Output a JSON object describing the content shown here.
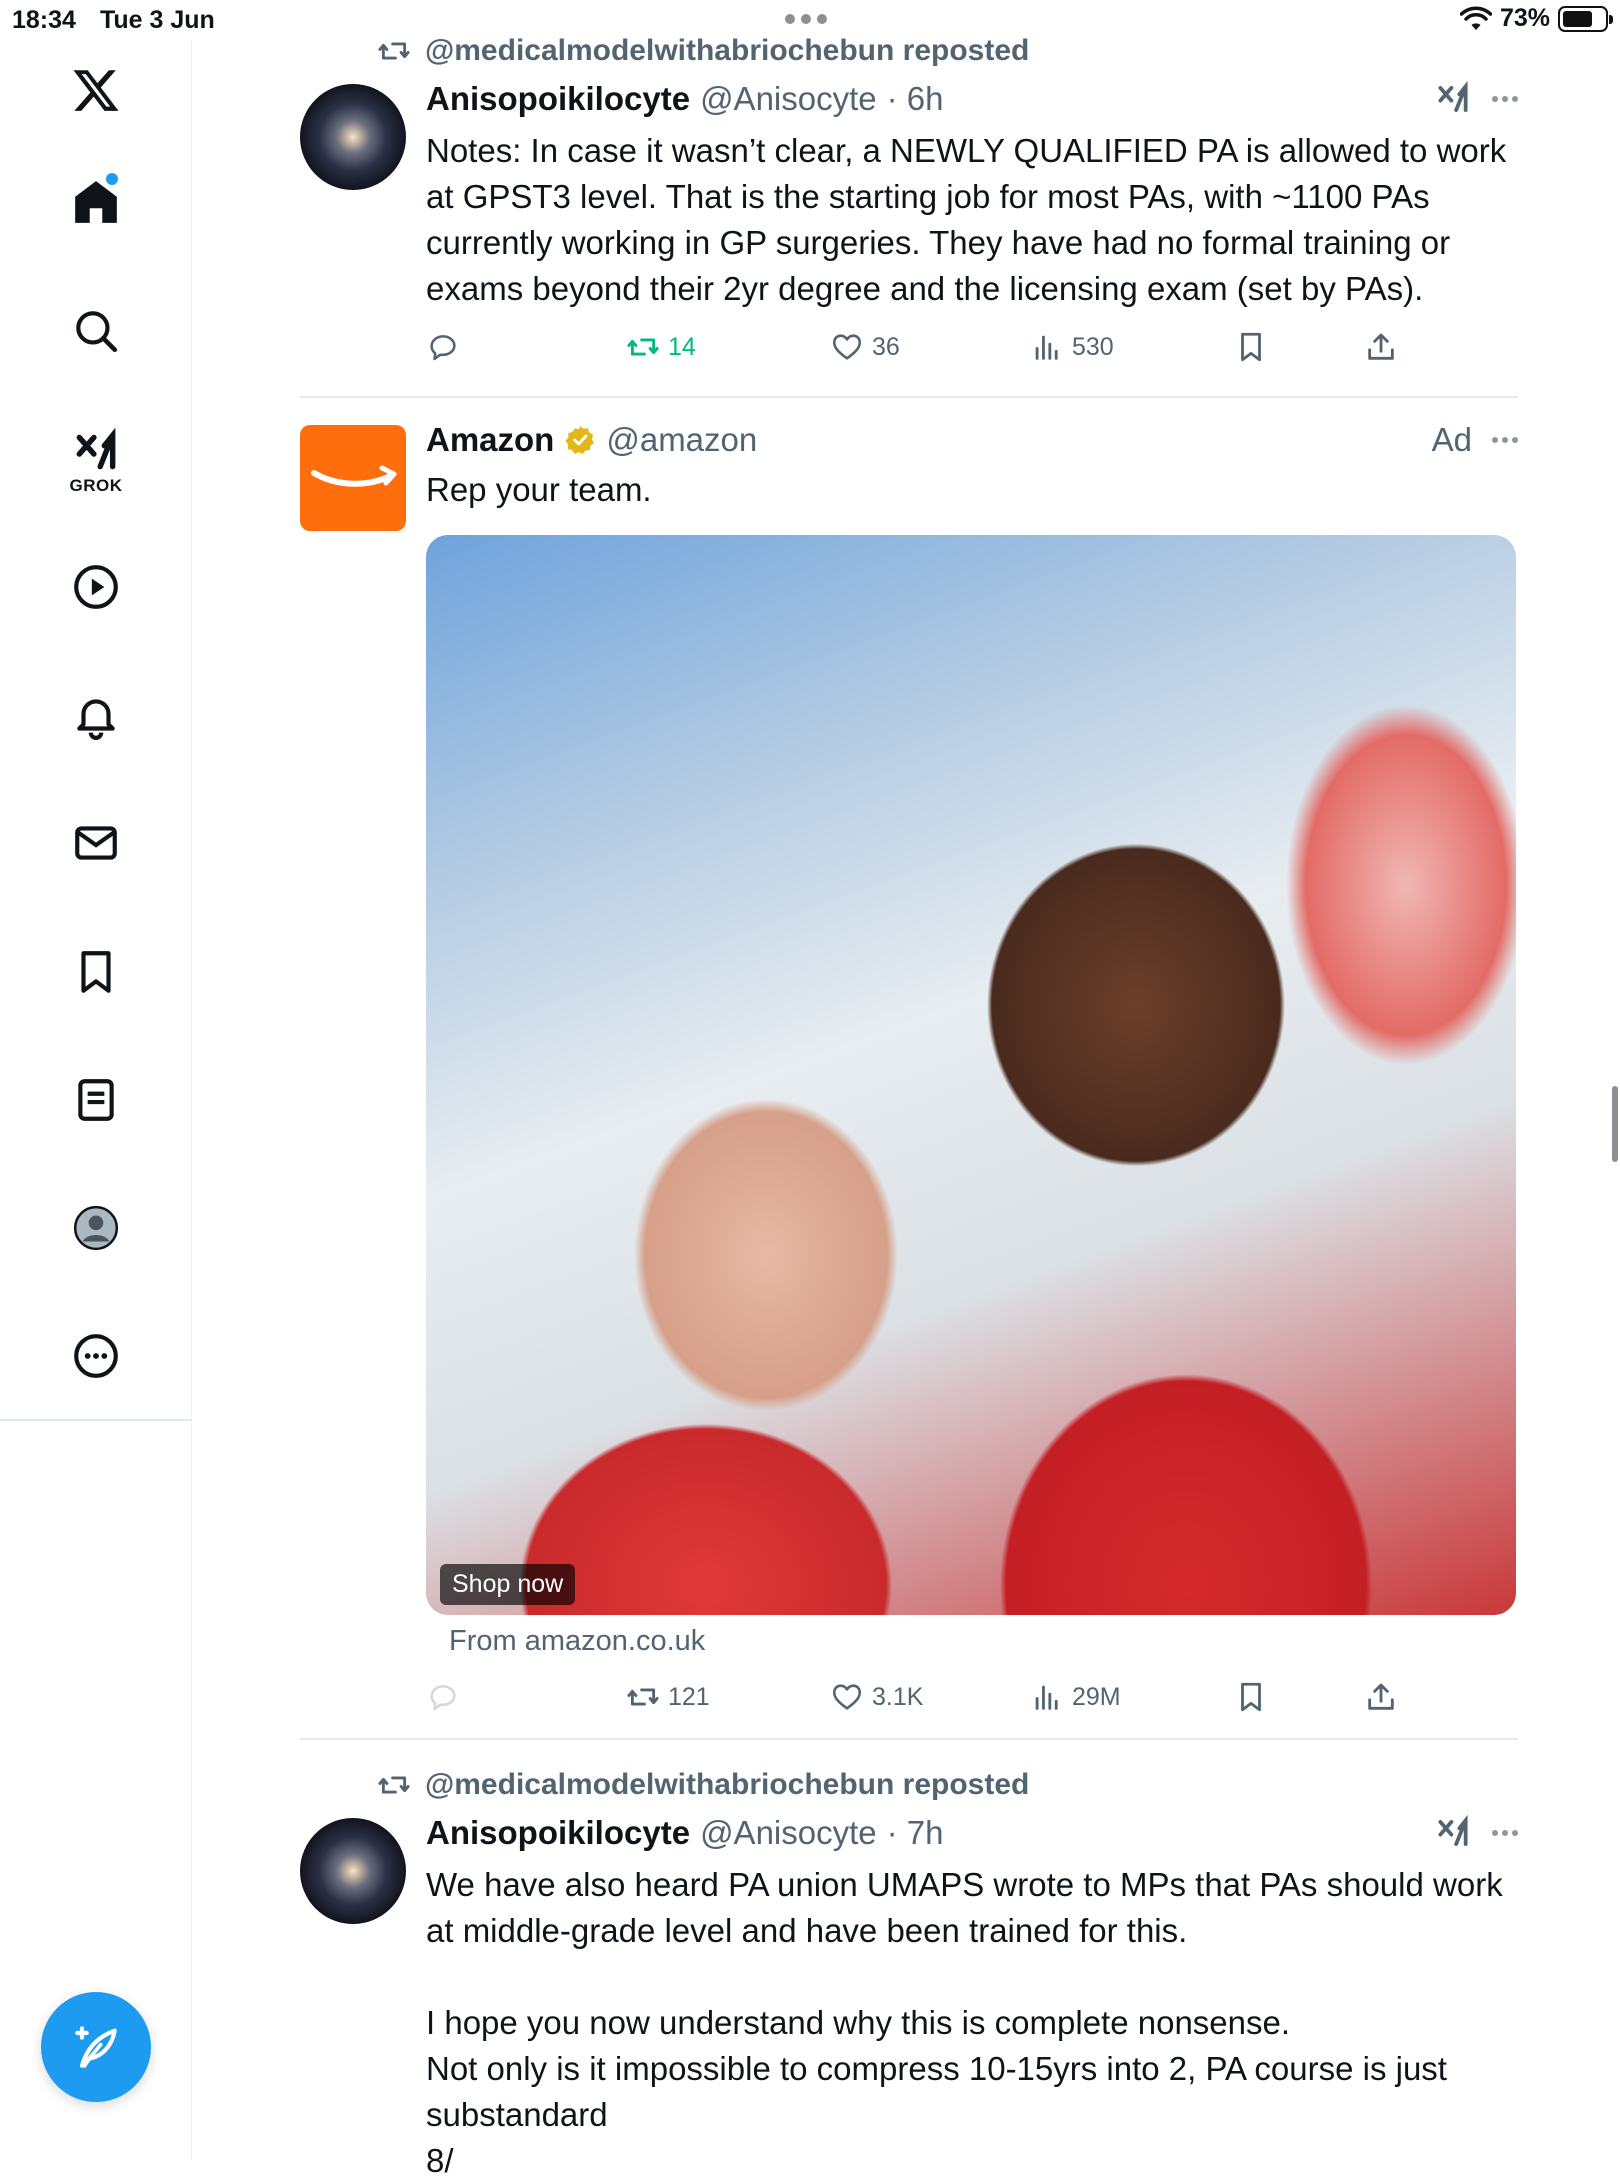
{
  "status_bar": {
    "time": "18:34",
    "date": "Tue 3 Jun",
    "battery": "73%",
    "battery_fraction": 0.73
  },
  "sidebar": {
    "items": [
      {
        "name": "x-logo-icon"
      },
      {
        "name": "home-icon",
        "active": true
      },
      {
        "name": "search-icon"
      },
      {
        "name": "grok-icon",
        "label": "GROK"
      },
      {
        "name": "video-icon"
      },
      {
        "name": "notifications-icon"
      },
      {
        "name": "messages-icon"
      },
      {
        "name": "bookmarks-icon"
      },
      {
        "name": "lists-icon"
      },
      {
        "name": "profile-icon"
      },
      {
        "name": "more-icon"
      }
    ],
    "compose": "compose-post-icon"
  },
  "posts": [
    {
      "repost_by": "@medicalmodelwithabriochebun reposted",
      "name": "Anisopoikilocyte",
      "handle": "@Anisocyte",
      "time": "· 6h",
      "text": "Notes: In case it wasn’t clear, a NEWLY QUALIFIED PA is allowed to work at GPST3 level. That is the starting job for most PAs, with ~1100 PAs currently working in GP surgeries. They have had no formal training or exams beyond their 2yr degree and the licensing exam (set by PAs).",
      "stats": {
        "reposts": "14",
        "likes": "36",
        "views": "530"
      }
    },
    {
      "name": "Amazon",
      "handle": "@amazon",
      "ad_label": "Ad",
      "text": "Rep your team.",
      "media_cta": "Shop now",
      "source": "From amazon.co.uk",
      "stats": {
        "reposts": "121",
        "likes": "3.1K",
        "views": "29M"
      }
    },
    {
      "repost_by": "@medicalmodelwithabriochebun reposted",
      "name": "Anisopoikilocyte",
      "handle": "@Anisocyte",
      "time": "· 7h",
      "text": "We have also heard PA union UMAPS wrote to MPs that PAs should work at middle-grade level and have been trained for this.\n\nI hope you now understand why this is complete nonsense.\nNot only is it impossible to compress 10-15yrs into 2, PA course is just substandard\n8/"
    }
  ],
  "colors": {
    "accent": "#1d9bf0",
    "repost_green": "#00ba7c",
    "secondary_text": "#536471",
    "amazon_orange": "#ff6e0c",
    "verified_gold": "#e2b719"
  }
}
